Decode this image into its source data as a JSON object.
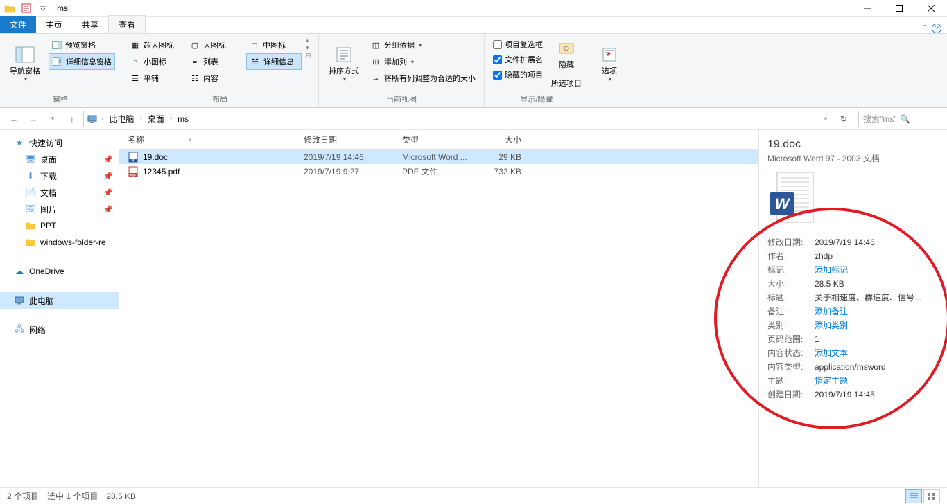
{
  "title": "ms",
  "tabs": {
    "file": "文件",
    "home": "主页",
    "share": "共享",
    "view": "查看"
  },
  "ribbon": {
    "panes_nav": "导航窗格",
    "panes_preview": "预览窗格",
    "panes_details": "详细信息窗格",
    "panes_group": "窗格",
    "layout_xl": "超大图标",
    "layout_lg": "大图标",
    "layout_md": "中图标",
    "layout_sm": "小图标",
    "layout_list": "列表",
    "layout_details": "详细信息",
    "layout_tiles": "平铺",
    "layout_content": "内容",
    "layout_group": "布局",
    "sort": "排序方式",
    "group_by": "分组依据",
    "add_cols": "添加列",
    "fit_cols": "将所有列调整为合适的大小",
    "view_group": "当前视图",
    "chk_checkboxes": "项目复选框",
    "chk_ext": "文件扩展名",
    "chk_hidden": "隐藏的项目",
    "hide_btn": "隐藏",
    "hide_btn2": "所选项目",
    "showhide_group": "显示/隐藏",
    "options": "选项"
  },
  "breadcrumb": [
    "此电脑",
    "桌面",
    "ms"
  ],
  "search_placeholder": "搜索\"ms\"",
  "columns": {
    "name": "名称",
    "date": "修改日期",
    "type": "类型",
    "size": "大小"
  },
  "files": [
    {
      "icon": "doc",
      "name": "19.doc",
      "date": "2019/7/19 14:46",
      "type": "Microsoft Word ...",
      "size": "29 KB",
      "selected": true
    },
    {
      "icon": "pdf",
      "name": "12345.pdf",
      "date": "2019/7/19 9:27",
      "type": "PDF 文件",
      "size": "732 KB",
      "selected": false
    }
  ],
  "nav": {
    "quick": "快速访问",
    "desktop": "桌面",
    "downloads": "下载",
    "documents": "文档",
    "pictures": "图片",
    "ppt": "PPT",
    "winfolder": "windows-folder-re",
    "onedrive": "OneDrive",
    "thispc": "此电脑",
    "network": "网络"
  },
  "details": {
    "title": "19.doc",
    "subtitle": "Microsoft Word 97 - 2003 文档",
    "props": [
      {
        "label": "修改日期:",
        "val": "2019/7/19 14:46"
      },
      {
        "label": "作者:",
        "val": "zhdp"
      },
      {
        "label": "标记:",
        "val": "添加标记",
        "ph": true
      },
      {
        "label": "大小:",
        "val": "28.5 KB"
      },
      {
        "label": "标题:",
        "val": "关于相速度、群速度、信号..."
      },
      {
        "label": "备注:",
        "val": "添加备注",
        "ph": true
      },
      {
        "label": "类别:",
        "val": "添加类别",
        "ph": true
      },
      {
        "label": "页码范围:",
        "val": "1"
      },
      {
        "label": "内容状态:",
        "val": "添加文本",
        "ph": true
      },
      {
        "label": "内容类型:",
        "val": "application/msword"
      },
      {
        "label": "主题:",
        "val": "指定主题",
        "ph": true
      },
      {
        "label": "创建日期:",
        "val": "2019/7/19 14:45"
      }
    ]
  },
  "status": {
    "count": "2 个项目",
    "selected": "选中 1 个项目",
    "size": "28.5 KB"
  }
}
